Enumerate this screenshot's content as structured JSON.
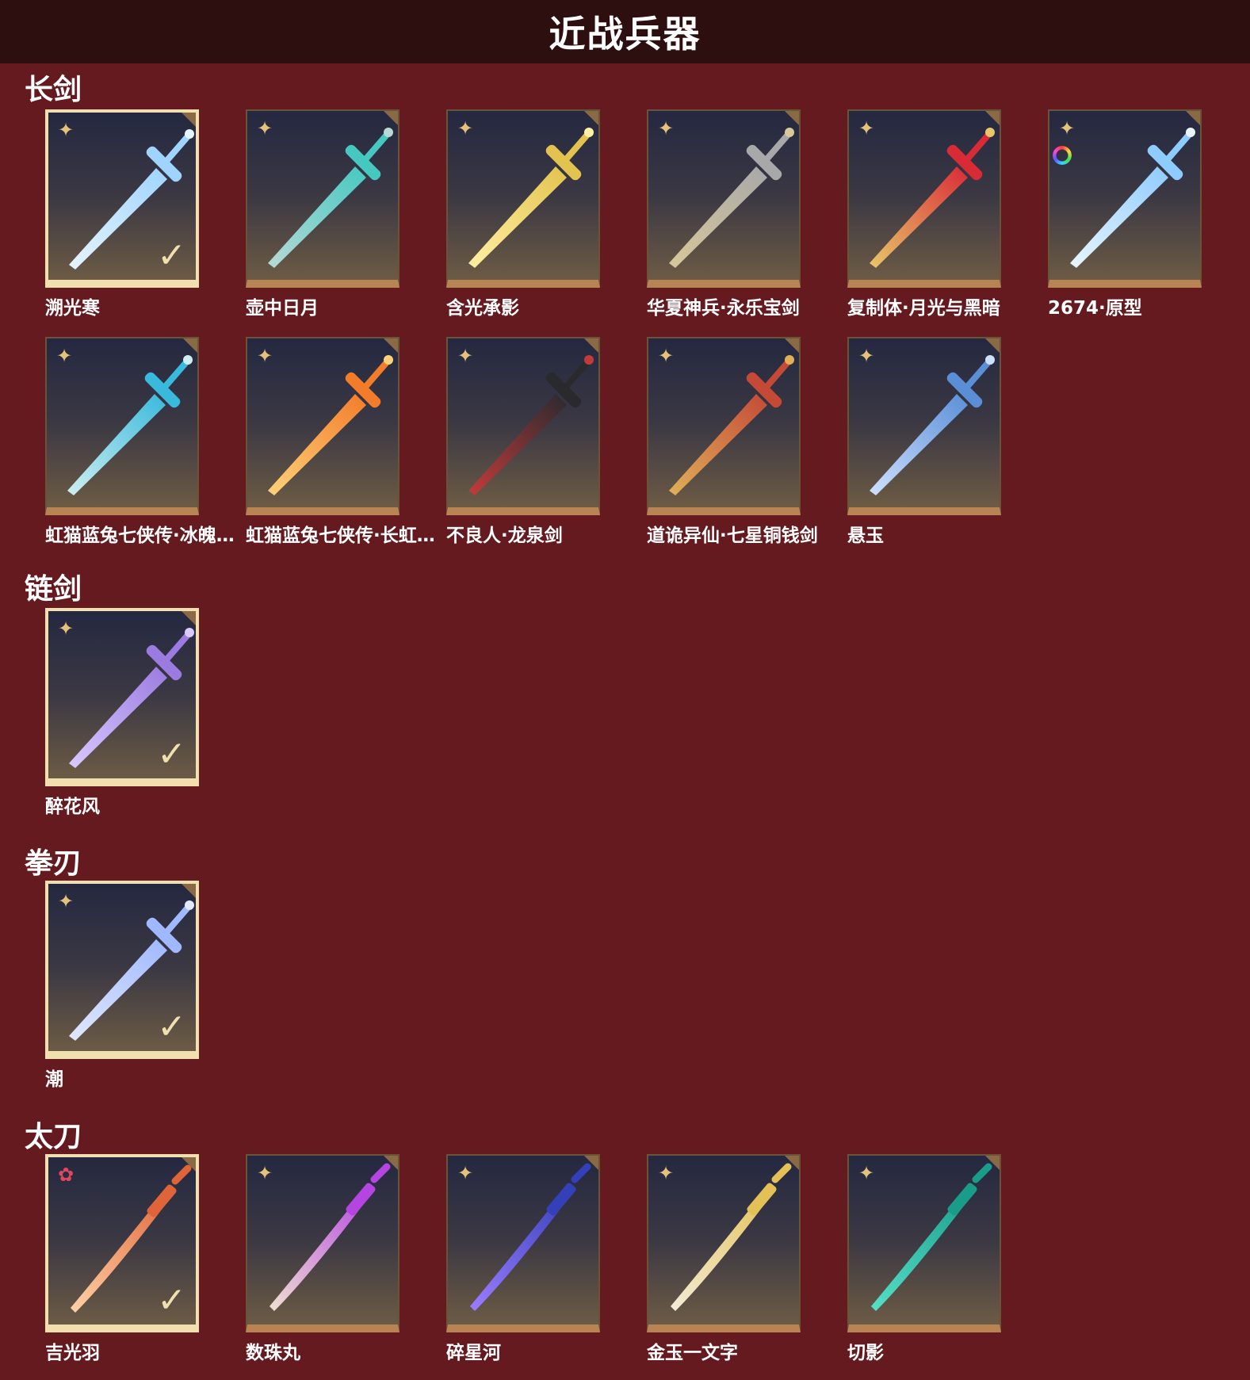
{
  "header": {
    "title": "近战兵器"
  },
  "sections": [
    {
      "title": "长剑",
      "items": [
        {
          "name": "溯光寒",
          "selected": true,
          "rarity": "gold-star",
          "weapon": "ice-crystal-sword",
          "colors": [
            "#9fd4ff",
            "#e6f4ff"
          ]
        },
        {
          "name": "壶中日月",
          "selected": false,
          "rarity": "gold-star",
          "weapon": "turquoise-sword",
          "colors": [
            "#46c8c0",
            "#b8d9d6"
          ]
        },
        {
          "name": "含光承影",
          "selected": false,
          "rarity": "gold-star",
          "weapon": "golden-sword",
          "colors": [
            "#e3c34f",
            "#fff0a3"
          ]
        },
        {
          "name": "华夏神兵·永乐宝剑",
          "selected": false,
          "rarity": "gold-star",
          "weapon": "steel-sword",
          "colors": [
            "#a8a8a8",
            "#d8c89a"
          ]
        },
        {
          "name": "复制体·月光与黑暗",
          "selected": false,
          "rarity": "gold-star",
          "weapon": "crimson-ring-sword",
          "colors": [
            "#d92b36",
            "#e8c76a"
          ]
        },
        {
          "name": "2674·原型",
          "selected": false,
          "rarity": "gold-star",
          "weapon": "laser-sword",
          "colors": [
            "#8ecbff",
            "#e8f6ff"
          ],
          "color_ring": true
        }
      ]
    },
    {
      "title": "",
      "items": [
        {
          "name": "虹猫蓝兔七侠传·冰魄…",
          "selected": false,
          "rarity": "gold-star",
          "weapon": "cyan-sword",
          "colors": [
            "#39b9dc",
            "#cfeef2"
          ]
        },
        {
          "name": "虹猫蓝兔七侠传·长虹…",
          "selected": false,
          "rarity": "gold-star",
          "weapon": "orange-sword",
          "colors": [
            "#f27c2a",
            "#ffd27a"
          ]
        },
        {
          "name": "不良人·龙泉剑",
          "selected": false,
          "rarity": "gold-star",
          "weapon": "dark-red-sword",
          "colors": [
            "#2a2a2e",
            "#c23b3b"
          ]
        },
        {
          "name": "道诡异仙·七星铜钱剑",
          "selected": false,
          "rarity": "gold-star",
          "weapon": "coin-sword",
          "colors": [
            "#c44a36",
            "#e0b058"
          ]
        },
        {
          "name": "悬玉",
          "selected": false,
          "rarity": "gold-star",
          "weapon": "blue-steel-sword",
          "colors": [
            "#5a8fd6",
            "#cfe0ff"
          ]
        }
      ]
    },
    {
      "title": "链剑",
      "items": [
        {
          "name": "醉花风",
          "selected": true,
          "rarity": "gold-star",
          "weapon": "chain-sword",
          "colors": [
            "#9b7be0",
            "#d9c9ff"
          ]
        }
      ]
    },
    {
      "title": "拳刃",
      "items": [
        {
          "name": "潮",
          "selected": true,
          "rarity": "gold-star",
          "weapon": "claw-blade",
          "colors": [
            "#9fb8ff",
            "#e1e8ff"
          ]
        }
      ]
    },
    {
      "title": "太刀",
      "items": [
        {
          "name": "吉光羽",
          "selected": true,
          "rarity": "red-star",
          "weapon": "flame-katana",
          "colors": [
            "#e0643a",
            "#ffd2a6"
          ]
        },
        {
          "name": "数珠丸",
          "selected": false,
          "rarity": "gold-star",
          "weapon": "purple-katana",
          "colors": [
            "#b545e0",
            "#efe0d2"
          ]
        },
        {
          "name": "碎星河",
          "selected": false,
          "rarity": "gold-star",
          "weapon": "navy-katana",
          "colors": [
            "#3440b8",
            "#9c7dff"
          ]
        },
        {
          "name": "金玉一文字",
          "selected": false,
          "rarity": "gold-star",
          "weapon": "gold-jade-katana",
          "colors": [
            "#e3c157",
            "#f3ecd8"
          ]
        },
        {
          "name": "切影",
          "selected": false,
          "rarity": "gold-star",
          "weapon": "emerald-katana",
          "colors": [
            "#1a9c8a",
            "#56e0c8"
          ]
        }
      ]
    }
  ],
  "icons": {
    "rarity": "four-point-star-icon",
    "check": "checkmark-icon",
    "corner": "corner-tab-icon",
    "color_ring": "color-wheel-icon"
  }
}
